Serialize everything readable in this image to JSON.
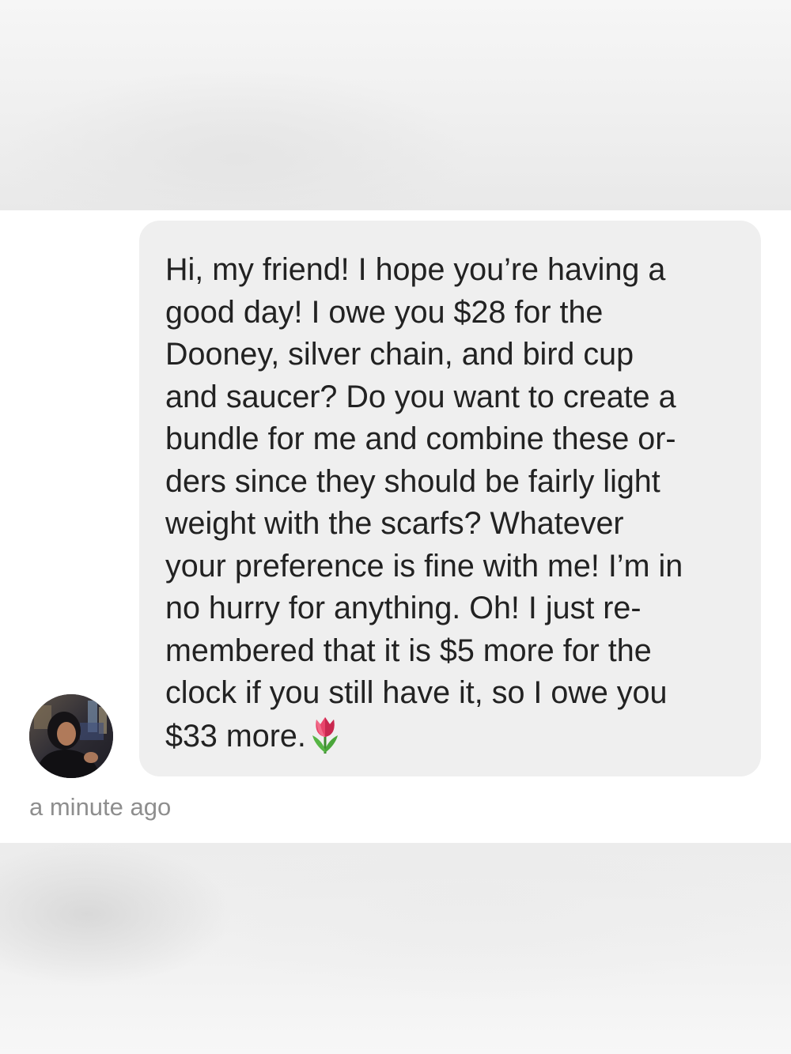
{
  "conversation": {
    "message": {
      "text": "Hi, my friend! I hope you’re having a\ngood day! I owe you $28 for the\nDooney, silver chain, and bird cup\nand saucer? Do you want to create a\nbundle for me and combine these or-\nders since they should be fairly light\nweight with the scarfs? Whatever\nyour preference is fine with me! I’m in\nno hurry for anything. Oh! I just re-\nmembered that it is $5 more for the\nclock if you still have it, so I owe you\n$33 more.",
      "emoji": "tulip-emoji",
      "timestamp": "a minute ago"
    },
    "sender": {
      "avatar": "profile-photo"
    }
  },
  "colors": {
    "bubble_background": "#efefef",
    "message_text": "#222222",
    "timestamp_text": "#8e8e8e",
    "panel_background": "#ffffff"
  }
}
